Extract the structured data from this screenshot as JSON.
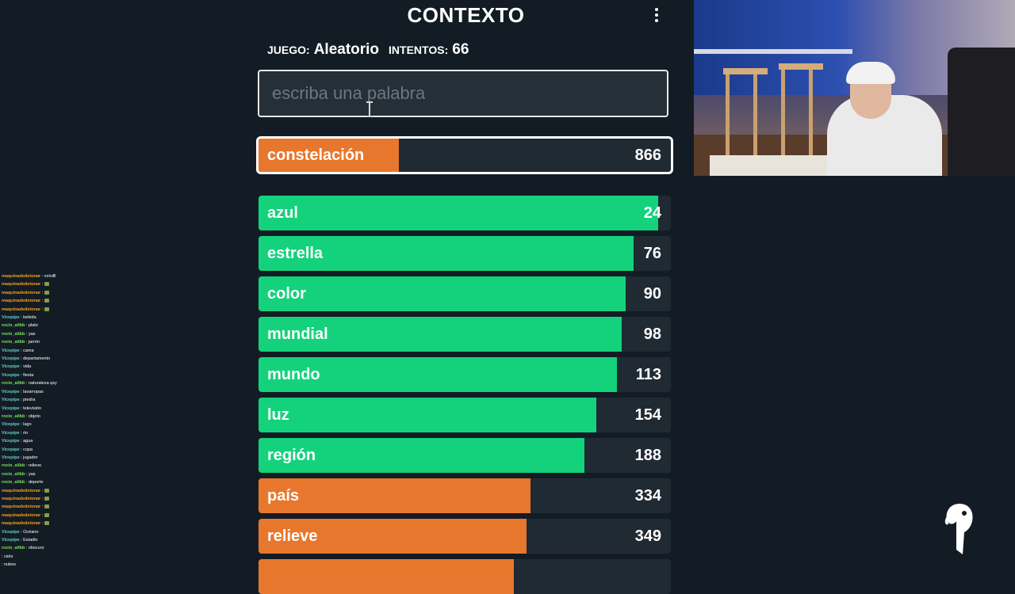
{
  "header": {
    "title": "CONTEXTO",
    "game_label": "JUEGO:",
    "game_value": "Aleatorio",
    "attempts_label": "INTENTOS:",
    "attempts_value": "66"
  },
  "search": {
    "placeholder": "escriba una palabra",
    "value": ""
  },
  "last_guess": {
    "word": "constelación",
    "rank": "866",
    "fill_percent": 34,
    "color": "#e8772e"
  },
  "guesses": [
    {
      "word": "azul",
      "rank": "24",
      "fill_percent": 97,
      "color": "green"
    },
    {
      "word": "estrella",
      "rank": "76",
      "fill_percent": 91,
      "color": "green"
    },
    {
      "word": "color",
      "rank": "90",
      "fill_percent": 89,
      "color": "green"
    },
    {
      "word": "mundial",
      "rank": "98",
      "fill_percent": 88,
      "color": "green"
    },
    {
      "word": "mundo",
      "rank": "113",
      "fill_percent": 87,
      "color": "green"
    },
    {
      "word": "luz",
      "rank": "154",
      "fill_percent": 82,
      "color": "green"
    },
    {
      "word": "región",
      "rank": "188",
      "fill_percent": 79,
      "color": "green"
    },
    {
      "word": "país",
      "rank": "334",
      "fill_percent": 66,
      "color": "orange"
    },
    {
      "word": "relieve",
      "rank": "349",
      "fill_percent": 65,
      "color": "orange"
    },
    {
      "word": "",
      "rank": "",
      "fill_percent": 62,
      "color": "orange"
    }
  ],
  "colors": {
    "background": "#131c24",
    "row_background": "#1f2a33",
    "green": "#14d27c",
    "orange": "#e8772e"
  },
  "chat": [
    {
      "user": "maquinadedetonar",
      "msg": "volvilll",
      "color": "#f0a020",
      "emote": false
    },
    {
      "user": "maquinadedetonar",
      "msg": "",
      "color": "#f0a020",
      "emote": true
    },
    {
      "user": "maquinadedetonar",
      "msg": "",
      "color": "#f0a020",
      "emote": true
    },
    {
      "user": "maquinadedetonar",
      "msg": "",
      "color": "#f0a020",
      "emote": true
    },
    {
      "user": "maquinadedetonar",
      "msg": "",
      "color": "#f0a020",
      "emote": true
    },
    {
      "user": "Vicepipe",
      "msg": "bebida",
      "color": "#5ed4c8",
      "emote": false
    },
    {
      "user": "rocio_alibb",
      "msg": "plato",
      "color": "#7be35a",
      "emote": false
    },
    {
      "user": "rocio_alibb",
      "msg": "yas",
      "color": "#7be35a",
      "emote": false
    },
    {
      "user": "rocio_alibb",
      "msg": "jarrón",
      "color": "#7be35a",
      "emote": false
    },
    {
      "user": "Vicepipe",
      "msg": "cama",
      "color": "#5ed4c8",
      "emote": false
    },
    {
      "user": "Vicepipe",
      "msg": "departamento",
      "color": "#5ed4c8",
      "emote": false
    },
    {
      "user": "Vicepipe",
      "msg": "vida",
      "color": "#5ed4c8",
      "emote": false
    },
    {
      "user": "Vicepipe",
      "msg": "fiesta",
      "color": "#5ed4c8",
      "emote": false
    },
    {
      "user": "rocio_alibb",
      "msg": "naturaleza qsy",
      "color": "#7be35a",
      "emote": false
    },
    {
      "user": "Vicepipe",
      "msg": "lavarropas",
      "color": "#5ed4c8",
      "emote": false
    },
    {
      "user": "Vicepipe",
      "msg": "piedra",
      "color": "#5ed4c8",
      "emote": false
    },
    {
      "user": "Vicepipe",
      "msg": "televisión",
      "color": "#5ed4c8",
      "emote": false
    },
    {
      "user": "rocio_alibb",
      "msg": "objeto",
      "color": "#7be35a",
      "emote": false
    },
    {
      "user": "Vicepipe",
      "msg": "lago",
      "color": "#5ed4c8",
      "emote": false
    },
    {
      "user": "Vicepipe",
      "msg": "rio",
      "color": "#5ed4c8",
      "emote": false
    },
    {
      "user": "Vicepipe",
      "msg": "agua",
      "color": "#5ed4c8",
      "emote": false
    },
    {
      "user": "Vicepipe",
      "msg": "copa",
      "color": "#5ed4c8",
      "emote": false
    },
    {
      "user": "Vicepipe",
      "msg": "jugador",
      "color": "#5ed4c8",
      "emote": false
    },
    {
      "user": "rocio_alibb",
      "msg": "relieve",
      "color": "#7be35a",
      "emote": false
    },
    {
      "user": "rocio_alibb",
      "msg": "yas",
      "color": "#7be35a",
      "emote": false
    },
    {
      "user": "rocio_alibb",
      "msg": "deporte",
      "color": "#7be35a",
      "emote": false
    },
    {
      "user": "maquinadedetonar",
      "msg": "",
      "color": "#f0a020",
      "emote": true
    },
    {
      "user": "maquinadedetonar",
      "msg": "",
      "color": "#f0a020",
      "emote": true
    },
    {
      "user": "maquinadedetonar",
      "msg": "",
      "color": "#f0a020",
      "emote": true
    },
    {
      "user": "maquinadedetonar",
      "msg": "",
      "color": "#f0a020",
      "emote": true
    },
    {
      "user": "maquinadedetonar",
      "msg": "",
      "color": "#f0a020",
      "emote": true
    },
    {
      "user": "Vicepipe",
      "msg": "Océano",
      "color": "#5ed4c8",
      "emote": false
    },
    {
      "user": "Vicepipe",
      "msg": "Estadio",
      "color": "#5ed4c8",
      "emote": false
    },
    {
      "user": "rocio_alibb",
      "msg": "obscuro",
      "color": "#7be35a",
      "emote": false
    },
    {
      "user": "",
      "msg": "cielo",
      "color": "#e0304a",
      "emote": false
    },
    {
      "user": "",
      "msg": "nubes",
      "color": "#e0304a",
      "emote": false
    }
  ],
  "icons": {
    "menu": "kebab-menu-icon",
    "logo": "toucan-logo-icon"
  }
}
